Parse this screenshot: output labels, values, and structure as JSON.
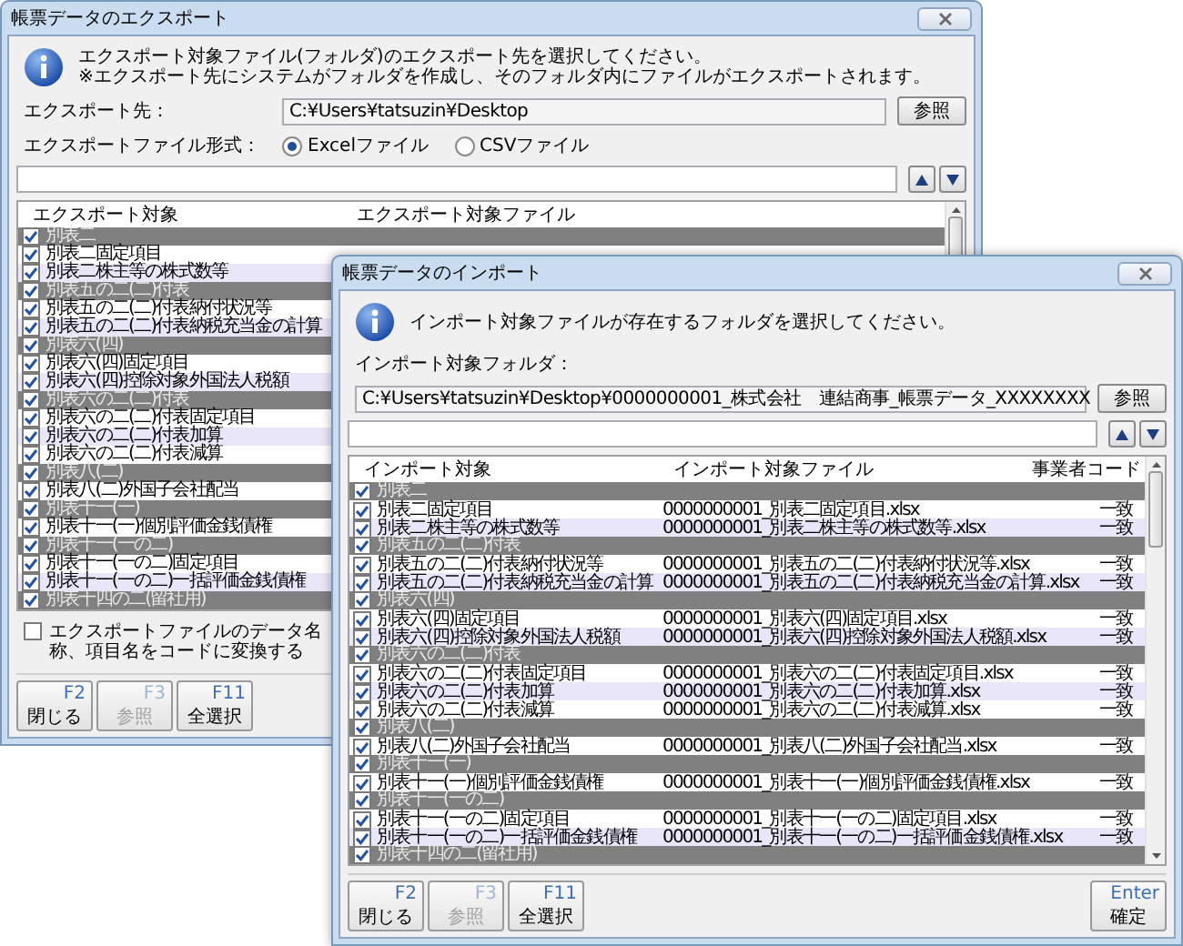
{
  "export_window": {
    "title": "帳票データのエクスポート",
    "message_lines": [
      "エクスポート対象ファイル(フォルダ)のエクスポート先を選択してください。",
      "※エクスポート先にシステムがフォルダを作成し、そのフォルダ内にファイルがエクスポートされます。"
    ],
    "destination": {
      "label": "エクスポート先：",
      "value": "C:¥Users¥tatsuzin¥Desktop",
      "browse_button": "参照"
    },
    "format": {
      "label": "エクスポートファイル形式：",
      "options": [
        {
          "label": "Excelファイル",
          "selected": true
        },
        {
          "label": "CSVファイル",
          "selected": false
        }
      ]
    },
    "table": {
      "columns": [
        "エクスポート対象",
        "エクスポート対象ファイル"
      ],
      "rows": [
        {
          "kind": "group",
          "label": "別表二",
          "checked": true
        },
        {
          "kind": "item",
          "label": "別表二固定項目",
          "checked": true
        },
        {
          "kind": "item",
          "label": "別表二株主等の株式数等",
          "checked": true
        },
        {
          "kind": "group",
          "label": "別表五の二(二)付表",
          "checked": true
        },
        {
          "kind": "item",
          "label": "別表五の二(二)付表納付状況等",
          "checked": true
        },
        {
          "kind": "item",
          "label": "別表五の二(二)付表納税充当金の計算",
          "checked": true
        },
        {
          "kind": "group",
          "label": "別表六(四)",
          "checked": true
        },
        {
          "kind": "item",
          "label": "別表六(四)固定項目",
          "checked": true
        },
        {
          "kind": "item",
          "label": "別表六(四)控除対象外国法人税額",
          "checked": true
        },
        {
          "kind": "group",
          "label": "別表六の二(二)付表",
          "checked": true
        },
        {
          "kind": "item",
          "label": "別表六の二(二)付表固定項目",
          "checked": true
        },
        {
          "kind": "item",
          "label": "別表六の二(二)付表加算",
          "checked": true
        },
        {
          "kind": "item",
          "label": "別表六の二(二)付表減算",
          "checked": true
        },
        {
          "kind": "group",
          "label": "別表八(二)",
          "checked": true
        },
        {
          "kind": "item",
          "label": "別表八(二)外国子会社配当",
          "checked": true
        },
        {
          "kind": "group",
          "label": "別表十一(一)",
          "checked": true
        },
        {
          "kind": "item",
          "label": "別表十一(一)個別評価金銭債権",
          "checked": true
        },
        {
          "kind": "group",
          "label": "別表十一(一の二)",
          "checked": true
        },
        {
          "kind": "item",
          "label": "別表十一(一の二)固定項目",
          "checked": true
        },
        {
          "kind": "item",
          "label": "別表十一(一の二)一括評価金銭債権",
          "checked": true
        },
        {
          "kind": "group",
          "label": "別表十四の二(留社用)",
          "checked": true
        }
      ]
    },
    "convert_option": {
      "label": "エクスポートファイルのデータ名称、項目名をコードに変換する",
      "checked": false
    },
    "buttons": [
      {
        "key": "F2",
        "label": "閉じる",
        "disabled": false
      },
      {
        "key": "F3",
        "label": "参照",
        "disabled": true
      },
      {
        "key": "F11",
        "label": "全選択",
        "disabled": false
      }
    ]
  },
  "import_window": {
    "title": "帳票データのインポート",
    "message_lines": [
      "インポート対象ファイルが存在するフォルダを選択してください。"
    ],
    "folder": {
      "label": "インポート対象フォルダ：",
      "value": "C:¥Users¥tatsuzin¥Desktop¥0000000001_株式会社　連結商事_帳票データ_XXXXXXXX",
      "browse_button": "参照"
    },
    "table": {
      "columns": [
        "インポート対象",
        "インポート対象ファイル",
        "事業者コード"
      ],
      "rows": [
        {
          "kind": "group",
          "label": "別表二",
          "checked": true
        },
        {
          "kind": "item",
          "label": "別表二固定項目",
          "checked": true,
          "file": "0000000001_別表二固定項目.xlsx",
          "code": "一致"
        },
        {
          "kind": "item",
          "label": "別表二株主等の株式数等",
          "checked": true,
          "file": "0000000001_別表二株主等の株式数等.xlsx",
          "code": "一致"
        },
        {
          "kind": "group",
          "label": "別表五の二(二)付表",
          "checked": true
        },
        {
          "kind": "item",
          "label": "別表五の二(二)付表納付状況等",
          "checked": true,
          "file": "0000000001_別表五の二(二)付表納付状況等.xlsx",
          "code": "一致"
        },
        {
          "kind": "item",
          "label": "別表五の二(二)付表納税充当金の計算",
          "checked": true,
          "file": "0000000001_別表五の二(二)付表納税充当金の計算.xlsx",
          "code": "一致"
        },
        {
          "kind": "group",
          "label": "別表六(四)",
          "checked": true
        },
        {
          "kind": "item",
          "label": "別表六(四)固定項目",
          "checked": true,
          "file": "0000000001_別表六(四)固定項目.xlsx",
          "code": "一致"
        },
        {
          "kind": "item",
          "label": "別表六(四)控除対象外国法人税額",
          "checked": true,
          "file": "0000000001_別表六(四)控除対象外国法人税額.xlsx",
          "code": "一致"
        },
        {
          "kind": "group",
          "label": "別表六の二(二)付表",
          "checked": true
        },
        {
          "kind": "item",
          "label": "別表六の二(二)付表固定項目",
          "checked": true,
          "file": "0000000001_別表六の二(二)付表固定項目.xlsx",
          "code": "一致"
        },
        {
          "kind": "item",
          "label": "別表六の二(二)付表加算",
          "checked": true,
          "file": "0000000001_別表六の二(二)付表加算.xlsx",
          "code": "一致"
        },
        {
          "kind": "item",
          "label": "別表六の二(二)付表減算",
          "checked": true,
          "file": "0000000001_別表六の二(二)付表減算.xlsx",
          "code": "一致"
        },
        {
          "kind": "group",
          "label": "別表八(二)",
          "checked": true
        },
        {
          "kind": "item",
          "label": "別表八(二)外国子会社配当",
          "checked": true,
          "file": "0000000001_別表八(二)外国子会社配当.xlsx",
          "code": "一致"
        },
        {
          "kind": "group",
          "label": "別表十一(一)",
          "checked": true
        },
        {
          "kind": "item",
          "label": "別表十一(一)個別評価金銭債権",
          "checked": true,
          "file": "0000000001_別表十一(一)個別評価金銭債権.xlsx",
          "code": "一致"
        },
        {
          "kind": "group",
          "label": "別表十一(一の二)",
          "checked": true
        },
        {
          "kind": "item",
          "label": "別表十一(一の二)固定項目",
          "checked": true,
          "file": "0000000001_別表十一(一の二)固定項目.xlsx",
          "code": "一致"
        },
        {
          "kind": "item",
          "label": "別表十一(一の二)一括評価金銭債権",
          "checked": true,
          "file": "0000000001_別表十一(一の二)一括評価金銭債権.xlsx",
          "code": "一致"
        },
        {
          "kind": "group",
          "label": "別表十四の二(留社用)",
          "checked": true
        }
      ]
    },
    "buttons": [
      {
        "key": "F2",
        "label": "閉じる",
        "disabled": false
      },
      {
        "key": "F3",
        "label": "参照",
        "disabled": true
      },
      {
        "key": "F11",
        "label": "全選択",
        "disabled": false
      }
    ],
    "right_buttons": [
      {
        "key": "Enter",
        "label": "確定",
        "disabled": false
      }
    ]
  }
}
